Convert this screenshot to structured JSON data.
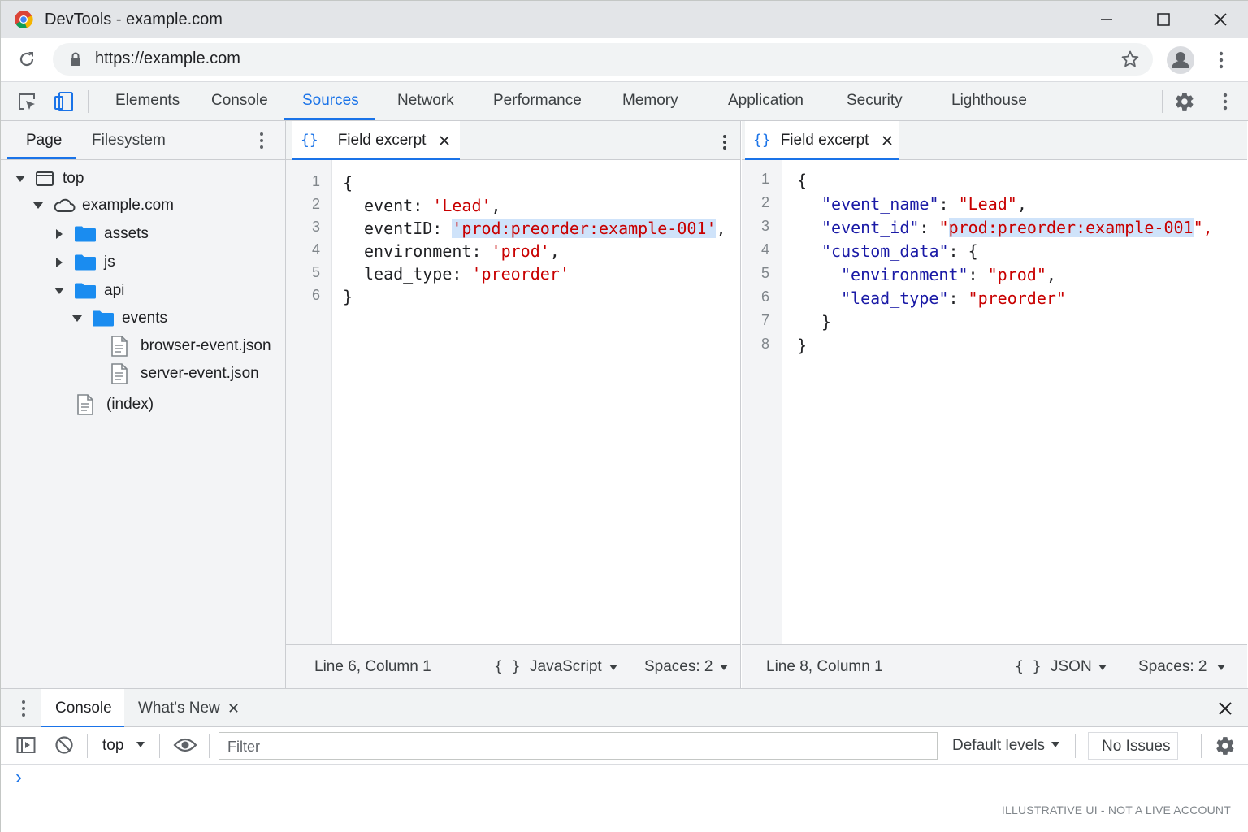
{
  "window": {
    "title": "DevTools - example.com"
  },
  "address_bar": {
    "url": "https://example.com"
  },
  "devtools_tabs": [
    "Elements",
    "Console",
    "Sources",
    "Network",
    "Performance",
    "Memory",
    "Application",
    "Security",
    "Lighthouse"
  ],
  "active_devtools_tab": "Sources",
  "navigator": {
    "tabs": [
      "Page",
      "Filesystem"
    ],
    "tree": {
      "top": "top",
      "domain": "example.com",
      "assets": "assets",
      "js": "js",
      "api": "api",
      "events": "events",
      "file1": "browser-event.json",
      "file2": "server-event.json",
      "index": "(index)"
    }
  },
  "left_editor": {
    "tab_icon": "{}",
    "tab_label": "Field excerpt",
    "line_numbers": [
      "1",
      "2",
      "3",
      "4",
      "5",
      "6"
    ],
    "lines": {
      "l1": "{",
      "l2_key": "event: ",
      "l2_val": "'Lead'",
      "l2_end": ",",
      "l3_key": "eventID: ",
      "l3_val": "'prod:preorder:example-001'",
      "l3_end": ",",
      "l4_key": "environment: ",
      "l4_val": "'prod'",
      "l4_end": ",",
      "l5_key": "lead_type: ",
      "l5_val": "'preorder'",
      "l6": "}"
    },
    "status": {
      "position": "Line 6,  Column 1",
      "format_icon": "{ }",
      "language": "JavaScript",
      "spaces": "Spaces: 2"
    }
  },
  "right_editor": {
    "tab_icon": "{}",
    "tab_label": "Field excerpt",
    "line_numbers": [
      "1",
      "2",
      "3",
      "4",
      "5",
      "6",
      "7",
      "8"
    ],
    "lines": {
      "l1": "{",
      "l2_key": "\"event_name\"",
      "l2_val": "\"Lead\"",
      "l3_key": "\"event_id\"",
      "l3_q": "\"",
      "l3_val": "prod:preorder:example-001",
      "l3_end": "\",",
      "l4_key": "\"custom_data\"",
      "l4_end": ": {",
      "l5_key": "\"environment\"",
      "l5_val": "\"prod\"",
      "l6_key": "\"lead_type\"",
      "l6_val": "\"preorder\"",
      "l7": "}",
      "l8": "}",
      "colon": ": ",
      "comma": ","
    },
    "status": {
      "position": "Line 8,  Column 1",
      "format_icon": "{ }",
      "language": "JSON",
      "spaces": "Spaces: 2"
    }
  },
  "drawer": {
    "tabs": [
      "Console",
      "What's New"
    ],
    "context": "top",
    "filter_placeholder": "Filter",
    "levels": "Default levels",
    "issues": "No Issues",
    "prompt": "›",
    "footer_note": "ILLUSTRATIVE UI - NOT A LIVE ACCOUNT"
  },
  "colors": {
    "accent": "#1a73e8",
    "string": "#c80000",
    "json_key": "#1a1aa6",
    "highlight": "#cfe3fa"
  }
}
